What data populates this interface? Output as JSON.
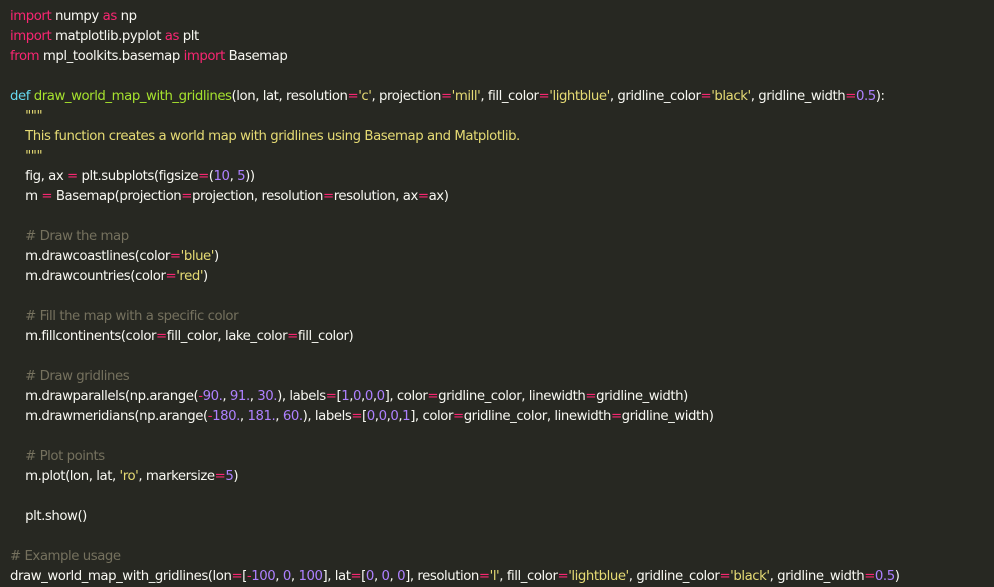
{
  "editor": {
    "language": "python",
    "theme_colors": {
      "background": "#272822",
      "text": "#f8f8f2",
      "keyword": "#f92672",
      "definition": "#66d9ef",
      "function_name": "#a6e22e",
      "string": "#e6db74",
      "number": "#ae81ff",
      "comment": "#75715e"
    },
    "lines": [
      [
        [
          "kw",
          "import"
        ],
        [
          "t",
          " numpy "
        ],
        [
          "kw",
          "as"
        ],
        [
          "t",
          " np"
        ]
      ],
      [
        [
          "kw",
          "import"
        ],
        [
          "t",
          " matplotlib.pyplot "
        ],
        [
          "kw",
          "as"
        ],
        [
          "t",
          " plt"
        ]
      ],
      [
        [
          "kw",
          "from"
        ],
        [
          "t",
          " mpl_toolkits.basemap "
        ],
        [
          "kw",
          "import"
        ],
        [
          "t",
          " Basemap"
        ]
      ],
      [],
      [
        [
          "def",
          "def"
        ],
        [
          "t",
          " "
        ],
        [
          "fn",
          "draw_world_map_with_gridlines"
        ],
        [
          "t",
          "(lon, lat, resolution"
        ],
        [
          "kw",
          "="
        ],
        [
          "str",
          "'c'"
        ],
        [
          "t",
          ", projection"
        ],
        [
          "kw",
          "="
        ],
        [
          "str",
          "'mill'"
        ],
        [
          "t",
          ", fill_color"
        ],
        [
          "kw",
          "="
        ],
        [
          "str",
          "'lightblue'"
        ],
        [
          "t",
          ", gridline_color"
        ],
        [
          "kw",
          "="
        ],
        [
          "str",
          "'black'"
        ],
        [
          "t",
          ", gridline_width"
        ],
        [
          "kw",
          "="
        ],
        [
          "num",
          "0.5"
        ],
        [
          "t",
          "):"
        ]
      ],
      [
        [
          "t",
          "    "
        ],
        [
          "str",
          "\"\"\""
        ]
      ],
      [
        [
          "t",
          "    "
        ],
        [
          "str",
          "This function creates a world map with gridlines using Basemap and Matplotlib."
        ]
      ],
      [
        [
          "t",
          "    "
        ],
        [
          "str",
          "\"\"\""
        ]
      ],
      [
        [
          "t",
          "    fig, ax "
        ],
        [
          "kw",
          "="
        ],
        [
          "t",
          " plt.subplots(figsize"
        ],
        [
          "kw",
          "="
        ],
        [
          "t",
          "("
        ],
        [
          "num",
          "10"
        ],
        [
          "t",
          ", "
        ],
        [
          "num",
          "5"
        ],
        [
          "t",
          "))"
        ]
      ],
      [
        [
          "t",
          "    m "
        ],
        [
          "kw",
          "="
        ],
        [
          "t",
          " Basemap(projection"
        ],
        [
          "kw",
          "="
        ],
        [
          "t",
          "projection, resolution"
        ],
        [
          "kw",
          "="
        ],
        [
          "t",
          "resolution, ax"
        ],
        [
          "kw",
          "="
        ],
        [
          "t",
          "ax)"
        ]
      ],
      [],
      [
        [
          "t",
          "    "
        ],
        [
          "com",
          "# Draw the map"
        ]
      ],
      [
        [
          "t",
          "    m.drawcoastlines(color"
        ],
        [
          "kw",
          "="
        ],
        [
          "str",
          "'blue'"
        ],
        [
          "t",
          ")"
        ]
      ],
      [
        [
          "t",
          "    m.drawcountries(color"
        ],
        [
          "kw",
          "="
        ],
        [
          "str",
          "'red'"
        ],
        [
          "t",
          ")"
        ]
      ],
      [],
      [
        [
          "t",
          "    "
        ],
        [
          "com",
          "# Fill the map with a specific color"
        ]
      ],
      [
        [
          "t",
          "    m.fillcontinents(color"
        ],
        [
          "kw",
          "="
        ],
        [
          "t",
          "fill_color, lake_color"
        ],
        [
          "kw",
          "="
        ],
        [
          "t",
          "fill_color)"
        ]
      ],
      [],
      [
        [
          "t",
          "    "
        ],
        [
          "com",
          "# Draw gridlines"
        ]
      ],
      [
        [
          "t",
          "    m.drawparallels(np.arange("
        ],
        [
          "kw",
          "-"
        ],
        [
          "num",
          "90."
        ],
        [
          "t",
          ", "
        ],
        [
          "num",
          "91."
        ],
        [
          "t",
          ", "
        ],
        [
          "num",
          "30."
        ],
        [
          "t",
          "), labels"
        ],
        [
          "kw",
          "="
        ],
        [
          "t",
          "["
        ],
        [
          "num",
          "1"
        ],
        [
          "t",
          ","
        ],
        [
          "num",
          "0"
        ],
        [
          "t",
          ","
        ],
        [
          "num",
          "0"
        ],
        [
          "t",
          ","
        ],
        [
          "num",
          "0"
        ],
        [
          "t",
          "], color"
        ],
        [
          "kw",
          "="
        ],
        [
          "t",
          "gridline_color, linewidth"
        ],
        [
          "kw",
          "="
        ],
        [
          "t",
          "gridline_width)"
        ]
      ],
      [
        [
          "t",
          "    m.drawmeridians(np.arange("
        ],
        [
          "kw",
          "-"
        ],
        [
          "num",
          "180."
        ],
        [
          "t",
          ", "
        ],
        [
          "num",
          "181."
        ],
        [
          "t",
          ", "
        ],
        [
          "num",
          "60."
        ],
        [
          "t",
          "), labels"
        ],
        [
          "kw",
          "="
        ],
        [
          "t",
          "["
        ],
        [
          "num",
          "0"
        ],
        [
          "t",
          ","
        ],
        [
          "num",
          "0"
        ],
        [
          "t",
          ","
        ],
        [
          "num",
          "0"
        ],
        [
          "t",
          ","
        ],
        [
          "num",
          "1"
        ],
        [
          "t",
          "], color"
        ],
        [
          "kw",
          "="
        ],
        [
          "t",
          "gridline_color, linewidth"
        ],
        [
          "kw",
          "="
        ],
        [
          "t",
          "gridline_width)"
        ]
      ],
      [],
      [
        [
          "t",
          "    "
        ],
        [
          "com",
          "# Plot points"
        ]
      ],
      [
        [
          "t",
          "    m.plot(lon, lat, "
        ],
        [
          "str",
          "'ro'"
        ],
        [
          "t",
          ", markersize"
        ],
        [
          "kw",
          "="
        ],
        [
          "num",
          "5"
        ],
        [
          "t",
          ")"
        ]
      ],
      [],
      [
        [
          "t",
          "    plt.show()"
        ]
      ],
      [],
      [
        [
          "com",
          "# Example usage"
        ]
      ],
      [
        [
          "t",
          "draw_world_map_with_gridlines(lon"
        ],
        [
          "kw",
          "="
        ],
        [
          "t",
          "["
        ],
        [
          "kw",
          "-"
        ],
        [
          "num",
          "100"
        ],
        [
          "t",
          ", "
        ],
        [
          "num",
          "0"
        ],
        [
          "t",
          ", "
        ],
        [
          "num",
          "100"
        ],
        [
          "t",
          "], lat"
        ],
        [
          "kw",
          "="
        ],
        [
          "t",
          "["
        ],
        [
          "num",
          "0"
        ],
        [
          "t",
          ", "
        ],
        [
          "num",
          "0"
        ],
        [
          "t",
          ", "
        ],
        [
          "num",
          "0"
        ],
        [
          "t",
          "], resolution"
        ],
        [
          "kw",
          "="
        ],
        [
          "str",
          "'l'"
        ],
        [
          "t",
          ", fill_color"
        ],
        [
          "kw",
          "="
        ],
        [
          "str",
          "'lightblue'"
        ],
        [
          "t",
          ", gridline_color"
        ],
        [
          "kw",
          "="
        ],
        [
          "str",
          "'black'"
        ],
        [
          "t",
          ", gridline_width"
        ],
        [
          "kw",
          "="
        ],
        [
          "num",
          "0.5"
        ],
        [
          "t",
          ")"
        ]
      ]
    ]
  }
}
